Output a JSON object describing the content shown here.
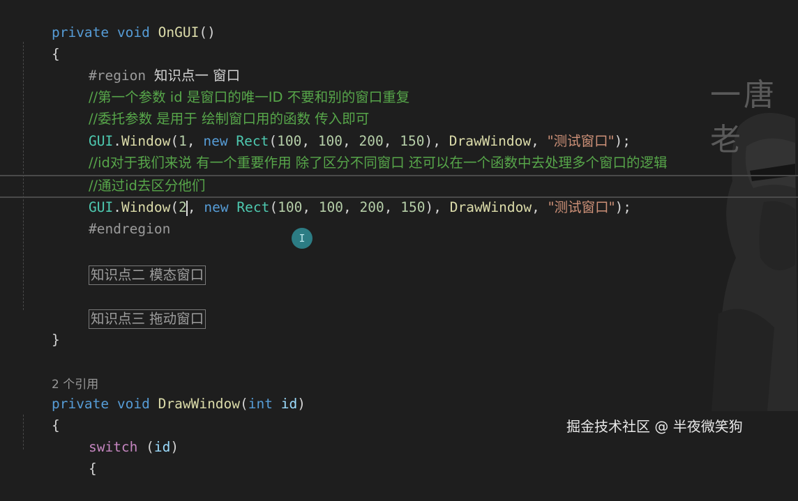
{
  "code": {
    "l1": {
      "kw_private": "private",
      "kw_void": "void",
      "fn": "OnGUI",
      "paren": "()"
    },
    "l2": "{",
    "l3": {
      "region": "#region",
      "title": "知识点一 窗口"
    },
    "l4": "//第一个参数 id 是窗口的唯一ID 不要和别的窗口重复",
    "l5": "//委托参数 是用于 绘制窗口用的函数 传入即可",
    "l6": {
      "gui": "GUI",
      "dot": ".",
      "fn": "Window",
      "open": "(",
      "arg1": "1",
      "sep1": ", ",
      "kw_new": "new",
      "sp": " ",
      "rect": "Rect",
      "open2": "(",
      "n1": "100",
      "c1": ", ",
      "n2": "100",
      "c2": ", ",
      "n3": "200",
      "c3": ", ",
      "n4": "150",
      "close2": "), ",
      "cb": "DrawWindow",
      "c4": ", ",
      "str": "\"测试窗口\"",
      "end": ");"
    },
    "l7": "//id对于我们来说 有一个重要作用 除了区分不同窗口 还可以在一个函数中去处理多个窗口的逻辑",
    "l8": "//通过id去区分他们",
    "l9": {
      "gui": "GUI",
      "dot": ".",
      "fn": "Window",
      "open": "(",
      "arg1": "2",
      "sep1": ", ",
      "kw_new": "new",
      "sp": " ",
      "rect": "Rect",
      "open2": "(",
      "n1": "100",
      "c1": ", ",
      "n2": "100",
      "c2": ", ",
      "n3": "200",
      "c3": ", ",
      "n4": "150",
      "close2": "), ",
      "cb": "DrawWindow",
      "c4": ", ",
      "str": "\"测试窗口\"",
      "end": ");"
    },
    "l10": "#endregion",
    "fold1": "知识点二 模态窗口",
    "fold2": "知识点三 拖动窗口",
    "l11": "}",
    "refs": "2 个引用",
    "l12": {
      "kw_private": "private",
      "kw_void": "void",
      "fn": "DrawWindow",
      "open": "(",
      "kw_int": "int",
      "param": "id",
      "close": ")"
    },
    "l13": "{",
    "l14": {
      "kw_switch": "switch",
      "open": " (",
      "param": "id",
      "close": ")"
    },
    "l15": "{"
  },
  "watermark_top": "一唐老",
  "watermark_bottom": "掘金技术社区 @ 半夜微笑狗",
  "cursor_icon": "text-cursor-icon",
  "colors": {
    "background": "#1e1e1e",
    "keyword": "#569cd6",
    "control_keyword": "#c586c0",
    "function": "#dcdcaa",
    "type": "#4ec9b0",
    "identifier": "#9cdcfe",
    "string": "#ce9178",
    "number": "#b5cea8",
    "comment": "#57a64a"
  }
}
